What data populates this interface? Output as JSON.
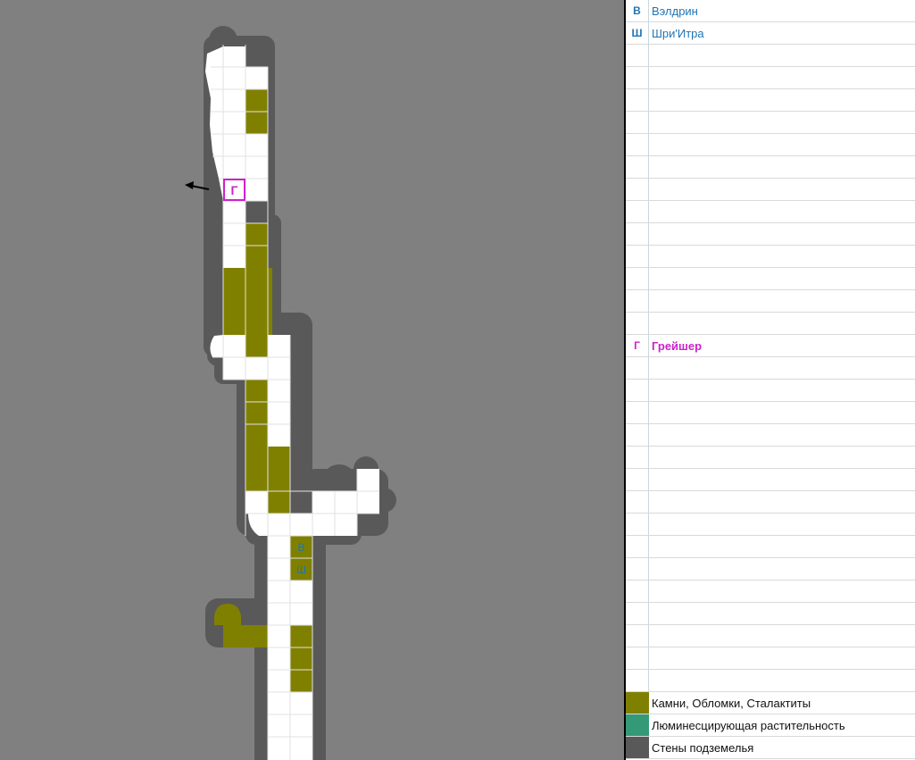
{
  "map": {
    "token_v": "В",
    "token_sh": "Ш",
    "token_g": "Г"
  },
  "panel": {
    "rows": [
      {
        "marker": "В",
        "name": "Вэлдрин",
        "style": "blue"
      },
      {
        "marker": "Ш",
        "name": "Шри'Итра",
        "style": "blue"
      },
      {
        "marker": "Г",
        "name": "Грейшер",
        "style": "mag"
      }
    ],
    "legend": [
      {
        "label": "Камни, Обломки, Сталактиты",
        "color": "#808000"
      },
      {
        "label": "Люминесцирующая растительность",
        "color": "#339977"
      },
      {
        "label": "Стены подземелья",
        "color": "#595959"
      }
    ]
  },
  "colors": {
    "background": "#808080",
    "wall": "#595959",
    "floor": "#ffffff",
    "rocks": "#808000",
    "blue_text": "#1f74b5",
    "magenta": "#cc22cc"
  }
}
